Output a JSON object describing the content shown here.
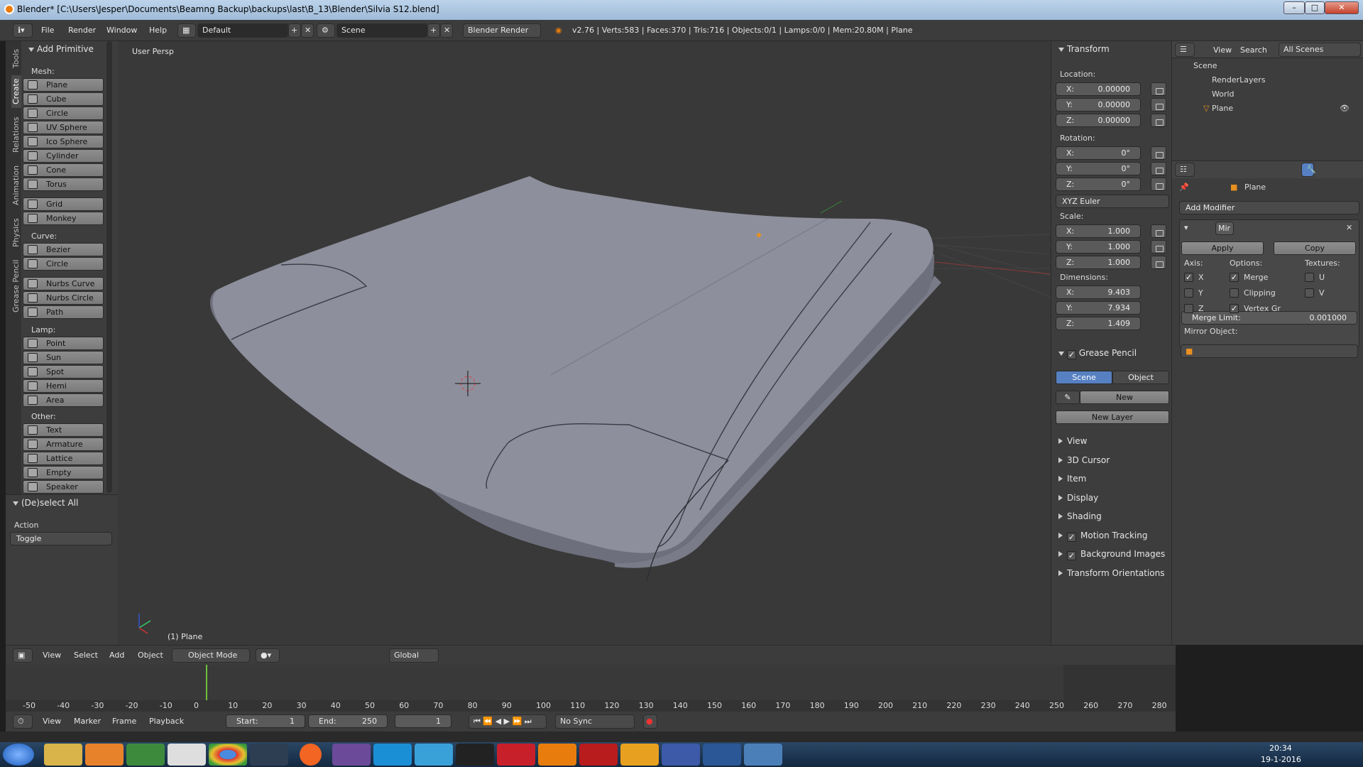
{
  "window": {
    "title": "Blender* [C:\\Users\\Jesper\\Documents\\Beamng Backup\\backups\\last\\B_13\\Blender\\Silvia S12.blend]"
  },
  "infobar": {
    "menus": [
      "File",
      "Render",
      "Window",
      "Help"
    ],
    "layout": "Default",
    "scene": "Scene",
    "engine": "Blender Render",
    "stats": "v2.76 | Verts:583 | Faces:370 | Tris:716 | Objects:0/1 | Lamps:0/0 | Mem:20.80M | Plane"
  },
  "toolbar": {
    "tabs": [
      "Tools",
      "Create",
      "Relations",
      "Animation",
      "Physics",
      "Grease Pencil"
    ],
    "title": "Add Primitive",
    "mesh_label": "Mesh:",
    "mesh": [
      "Plane",
      "Cube",
      "Circle",
      "UV Sphere",
      "Ico Sphere",
      "Cylinder",
      "Cone",
      "Torus",
      "Grid",
      "Monkey"
    ],
    "curve_label": "Curve:",
    "curve": [
      "Bezier",
      "Circle",
      "Nurbs Curve",
      "Nurbs Circle",
      "Path"
    ],
    "lamp_label": "Lamp:",
    "lamp": [
      "Point",
      "Sun",
      "Spot",
      "Hemi",
      "Area"
    ],
    "other_label": "Other:",
    "other": [
      "Text",
      "Armature",
      "Lattice",
      "Empty",
      "Speaker"
    ],
    "deselect": {
      "title": "(De)select All",
      "action_label": "Action",
      "action_value": "Toggle"
    }
  },
  "viewport": {
    "view_label": "User Persp",
    "object_label": "(1) Plane"
  },
  "properties_panel": {
    "transform": "Transform",
    "location": "Location:",
    "loc": [
      [
        "X:",
        "0.00000"
      ],
      [
        "Y:",
        "0.00000"
      ],
      [
        "Z:",
        "0.00000"
      ]
    ],
    "rotation": "Rotation:",
    "rot": [
      [
        "X:",
        "0°"
      ],
      [
        "Y:",
        "0°"
      ],
      [
        "Z:",
        "0°"
      ]
    ],
    "rot_mode": "XYZ Euler",
    "scale": "Scale:",
    "scl": [
      [
        "X:",
        "1.000"
      ],
      [
        "Y:",
        "1.000"
      ],
      [
        "Z:",
        "1.000"
      ]
    ],
    "dimensions": "Dimensions:",
    "dim": [
      [
        "X:",
        "9.403"
      ],
      [
        "Y:",
        "7.934"
      ],
      [
        "Z:",
        "1.409"
      ]
    ],
    "grease_pencil": "Grease Pencil",
    "gp_scene": "Scene",
    "gp_object": "Object",
    "gp_new": "New",
    "gp_new_layer": "New Layer",
    "collapsed": [
      "View",
      "3D Cursor",
      "Item",
      "Display",
      "Shading",
      "Motion Tracking",
      "Background Images",
      "Transform Orientations"
    ]
  },
  "outliner": {
    "view": "View",
    "search": "Search",
    "filter": "All Scenes",
    "items": [
      "Scene",
      "RenderLayers",
      "World",
      "Plane"
    ]
  },
  "modifiers": {
    "object": "Plane",
    "add_modifier": "Add Modifier",
    "name": "Mir",
    "apply": "Apply",
    "copy": "Copy",
    "axis_label": "Axis:",
    "options_label": "Options:",
    "textures_label": "Textures:",
    "axes": [
      "X",
      "Y",
      "Z"
    ],
    "options": [
      "Merge",
      "Clipping",
      "Vertex Gr"
    ],
    "textures": [
      "U",
      "V"
    ],
    "merge_limit_label": "Merge Limit:",
    "merge_limit": "0.001000",
    "mirror_object_label": "Mirror Object:"
  },
  "view3d_header": {
    "menus": [
      "View",
      "Select",
      "Add",
      "Object"
    ],
    "mode": "Object Mode",
    "orientation": "Global"
  },
  "timeline": {
    "ticks": [
      "-50",
      "-40",
      "-30",
      "-20",
      "-10",
      "0",
      "10",
      "20",
      "30",
      "40",
      "50",
      "60",
      "70",
      "80",
      "90",
      "100",
      "110",
      "120",
      "130",
      "140",
      "150",
      "160",
      "170",
      "180",
      "190",
      "200",
      "210",
      "220",
      "230",
      "240",
      "250",
      "260",
      "270",
      "280"
    ],
    "menus": [
      "View",
      "Marker",
      "Frame",
      "Playback"
    ],
    "start_label": "Start:",
    "start": "1",
    "end_label": "End:",
    "end": "250",
    "current": "1",
    "sync": "No Sync"
  },
  "taskbar": {
    "time": "20:34",
    "date": "19-1-2016"
  },
  "colors": {
    "accent": "#5680c2",
    "orange": "#e87d0d",
    "viewport": "#393939"
  }
}
